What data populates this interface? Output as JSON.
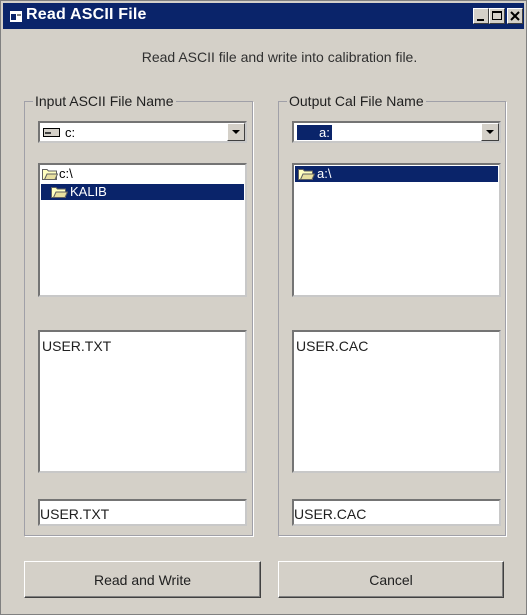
{
  "window": {
    "title": "Read ASCII File"
  },
  "description": "Read ASCII file and write into calibration file.",
  "input_group": {
    "label": "Input ASCII File Name",
    "drive": "c:",
    "folders": [
      {
        "name": "c:\\",
        "selected": false
      },
      {
        "name": "KALIB",
        "selected": true
      }
    ],
    "files": [
      "USER.TXT"
    ],
    "filename": "USER.TXT"
  },
  "output_group": {
    "label": "Output Cal File Name",
    "drive": "a:",
    "folders": [
      {
        "name": "a:\\",
        "selected": true
      }
    ],
    "files": [
      "USER.CAC"
    ],
    "filename": "USER.CAC"
  },
  "buttons": {
    "read_write": "Read and Write",
    "cancel": "Cancel"
  },
  "icons": {
    "title": "window-app-icon",
    "minimize": "minimize-icon",
    "maximize": "maximize-icon",
    "close": "close-icon",
    "drive": "hard-drive-icon",
    "floppy": "floppy-drive-icon",
    "folder_open": "folder-open-icon",
    "dropdown": "chevron-down-icon"
  },
  "colors": {
    "title_bar": "#0a246a",
    "selection": "#0a246a",
    "face": "#d4d0c8"
  }
}
